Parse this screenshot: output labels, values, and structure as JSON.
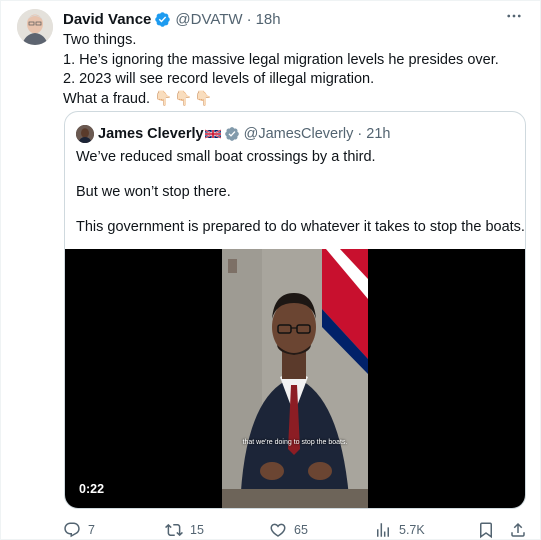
{
  "tweet": {
    "author_name": "David Vance",
    "author_handle": "@DVATW",
    "separator": "·",
    "timestamp": "18h",
    "more_icon": "more-horizontal-icon",
    "lines": [
      "Two things.",
      "1. He’s ignoring the massive legal migration levels he presides over.",
      "2. 2023 will see record levels of illegal migration.",
      "What a fraud."
    ],
    "emoji": "👇🏻👇🏻👇🏻"
  },
  "quote": {
    "author_name": "James Cleverly",
    "author_handle": "@JamesCleverly",
    "separator": "·",
    "timestamp": "21h",
    "paragraphs": [
      "We’ve reduced small boat crossings by a third.",
      "But we won’t stop there.",
      "This government is prepared to do whatever it takes to stop the boats."
    ],
    "video": {
      "caption": "that we're doing to stop the boats.",
      "duration": "0:22"
    }
  },
  "actions": {
    "replies": "7",
    "retweets": "15",
    "likes": "65",
    "views": "5.7K"
  },
  "colors": {
    "verified_blue": "#1d9bf0",
    "secondary_text": "#536471",
    "border": "#cfd9de"
  }
}
